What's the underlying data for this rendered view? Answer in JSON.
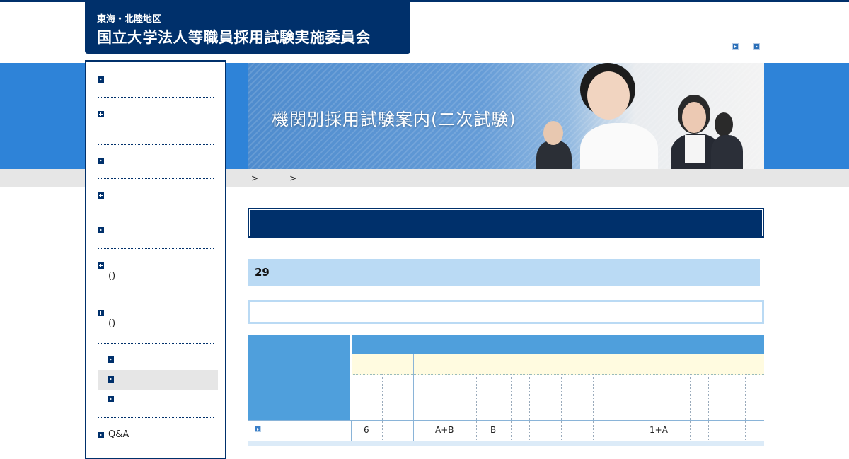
{
  "header": {
    "region": "東海・北陸地区",
    "org_name": "国立大学法人等職員採用試験実施委員会"
  },
  "hero": {
    "title": "機関別採用試験案内(二次試験)"
  },
  "breadcrumb": [
    ">",
    ">"
  ],
  "sidebar": {
    "items": [
      {
        "icon": "arrow",
        "label": ""
      },
      {
        "icon": "plus",
        "label": ""
      },
      {
        "icon": "arrow",
        "label": ""
      },
      {
        "icon": "plus",
        "label": ""
      },
      {
        "icon": "arrow",
        "label": ""
      },
      {
        "icon": "plus",
        "label": "()"
      },
      {
        "icon": "plus",
        "label": "()"
      },
      {
        "icon": "arrow",
        "label": "Q&A"
      }
    ],
    "subitems": [
      "",
      "",
      ""
    ]
  },
  "section": {
    "h2": "",
    "h3": "29"
  },
  "table": {
    "row1": {
      "c1": "6",
      "c2": "A+B",
      "c3": "B",
      "c4": "1+A"
    }
  },
  "colors": {
    "navy": "#00306b",
    "band_blue": "#2e83d8",
    "table_header": "#4f9fdc",
    "light_blue": "#badaf4",
    "cream": "#fffbe0"
  }
}
